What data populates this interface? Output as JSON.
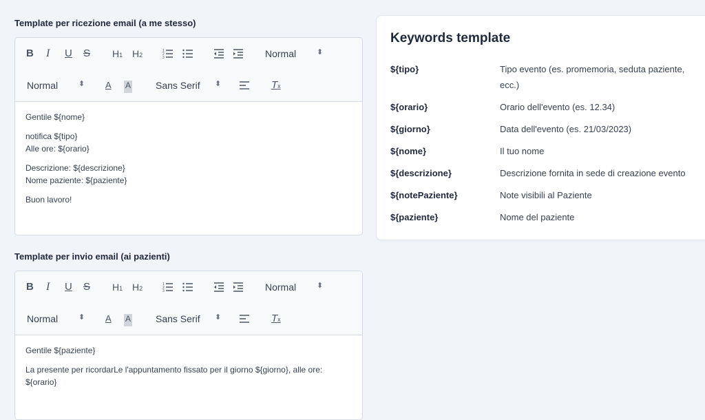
{
  "section1": {
    "label": "Template per ricezione email (a me stesso)",
    "toolbar": {
      "bold": "B",
      "italic": "I",
      "underline": "U",
      "strike": "S",
      "h1": "H",
      "h1_sub": "1",
      "h2": "H",
      "h2_sub": "2",
      "header_select": "Normal",
      "size_select": "Normal",
      "color": "A",
      "background": "A",
      "font_select": "Sans Serif",
      "clear": "T"
    },
    "content": [
      [
        "Gentile ${nome}"
      ],
      [
        "notifica ${tipo}",
        "Alle ore: ${orario}"
      ],
      [
        "Descrizione: ${descrizione}",
        "Nome paziente: ${paziente}"
      ],
      [
        "Buon lavoro!"
      ]
    ]
  },
  "section2": {
    "label": "Template per invio email (ai pazienti)",
    "toolbar": {
      "bold": "B",
      "italic": "I",
      "underline": "U",
      "strike": "S",
      "h1": "H",
      "h1_sub": "1",
      "h2": "H",
      "h2_sub": "2",
      "header_select": "Normal",
      "size_select": "Normal",
      "color": "A",
      "background": "A",
      "font_select": "Sans Serif",
      "clear": "T"
    },
    "content": [
      [
        "Gentile ${paziente}"
      ],
      [
        "La presente per ricordarLe l'appuntamento fissato per il giorno ${giorno}, alle ore:",
        "${orario}"
      ]
    ]
  },
  "keywords": {
    "title": "Keywords template",
    "rows": [
      {
        "key": "${tipo}",
        "desc": "Tipo evento (es. promemoria, seduta paziente, ecc.)"
      },
      {
        "key": "${orario}",
        "desc": "Orario dell'evento (es. 12.34)"
      },
      {
        "key": "${giorno}",
        "desc": "Data dell'evento (es. 21/03/2023)"
      },
      {
        "key": "${nome}",
        "desc": "Il tuo nome"
      },
      {
        "key": "${descrizione}",
        "desc": "Descrizione fornita in sede di creazione evento"
      },
      {
        "key": "${notePaziente}",
        "desc": "Note visibili al Paziente"
      },
      {
        "key": "${paziente}",
        "desc": "Nome del paziente"
      }
    ]
  },
  "colors": {
    "background": "#f1f4f8",
    "toolbar": "#f7f9fb",
    "border": "#d4dbe5",
    "text": "#1e293b"
  },
  "icons": [
    "ordered-list-icon",
    "bullet-list-icon",
    "outdent-icon",
    "indent-icon",
    "align-icon",
    "clear-format-icon",
    "select-arrows-icon"
  ]
}
